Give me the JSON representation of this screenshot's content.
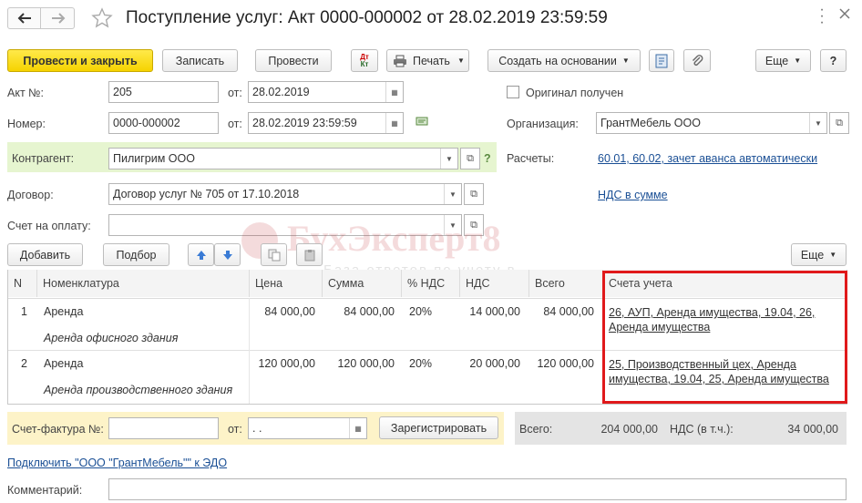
{
  "window": {
    "title": "Поступление услуг: Акт 0000-000002 от 28.02.2019 23:59:59",
    "star_icon": "star-icon",
    "more_icon": "more-vertical-icon",
    "close_icon": "close-icon"
  },
  "toolbar": {
    "post_close": "Провести и закрыть",
    "save": "Записать",
    "post": "Провести",
    "dtkt_top": "Дт",
    "dtkt_bottom": "Кт",
    "print": "Печать",
    "create_based": "Создать на основании",
    "more": "Еще",
    "help": "?"
  },
  "form": {
    "act_label": "Акт №:",
    "act_value": "205",
    "from_label": "от:",
    "act_date": "28.02.2019",
    "number_label": "Номер:",
    "number_value": "0000-000002",
    "number_date": "28.02.2019 23:59:59",
    "original_label": "Оригинал получен",
    "org_label": "Организация:",
    "org_value": "ГрантМебель ООО",
    "contractor_label": "Контрагент:",
    "contractor_value": "Пилигрим ООО",
    "contractor_help": "?",
    "settlements_label": "Расчеты:",
    "settlements_link": "60.01, 60.02, зачет аванса автоматически",
    "contract_label": "Договор:",
    "contract_value": "Договор услуг № 705 от 17.10.2018",
    "vat_link": "НДС в сумме",
    "invoice_pay_label": "Счет на оплату:",
    "invoice_pay_value": ""
  },
  "table_toolbar": {
    "add": "Добавить",
    "pick": "Подбор",
    "more": "Еще"
  },
  "watermark": {
    "title": "БухЭксперт8",
    "subtitle": "База ответов по учету в"
  },
  "table": {
    "headers": [
      "N",
      "Номенклатура",
      "Цена",
      "Сумма",
      "% НДС",
      "НДС",
      "Всего",
      "Счета учета"
    ],
    "rows": [
      {
        "n": "1",
        "name": "Аренда",
        "content": "Аренда офисного здания",
        "price": "84 000,00",
        "sum": "84 000,00",
        "vat_rate": "20%",
        "vat": "14 000,00",
        "total": "84 000,00",
        "accounts": "26, АУП, Аренда имущества, 19.04, 26, Аренда имущества"
      },
      {
        "n": "2",
        "name": "Аренда",
        "content": "Аренда производственного здания",
        "price": "120 000,00",
        "sum": "120 000,00",
        "vat_rate": "20%",
        "vat": "20 000,00",
        "total": "120 000,00",
        "accounts": "25, Производственный цех, Аренда имущества, 19.04, 25, Аренда имущества"
      }
    ]
  },
  "footer": {
    "invoice_label": "Счет-фактура №:",
    "invoice_value": "",
    "from_label": "от:",
    "invoice_date": " .  .",
    "register": "Зарегистрировать",
    "total_label": "Всего:",
    "total_value": "204 000,00",
    "vat_label": "НДС (в т.ч.):",
    "vat_value": "34 000,00",
    "edo_link": "Подключить \"ООО \"ГрантМебель\"\" к ЭДО",
    "comment_label": "Комментарий:",
    "comment_value": ""
  },
  "colors": {
    "accent_yellow": "#f6d300",
    "contractor_bg": "#e6f5d0",
    "footer_bg": "#fdf3c8",
    "highlight_red": "#e0191b",
    "link": "#1a4f95"
  }
}
